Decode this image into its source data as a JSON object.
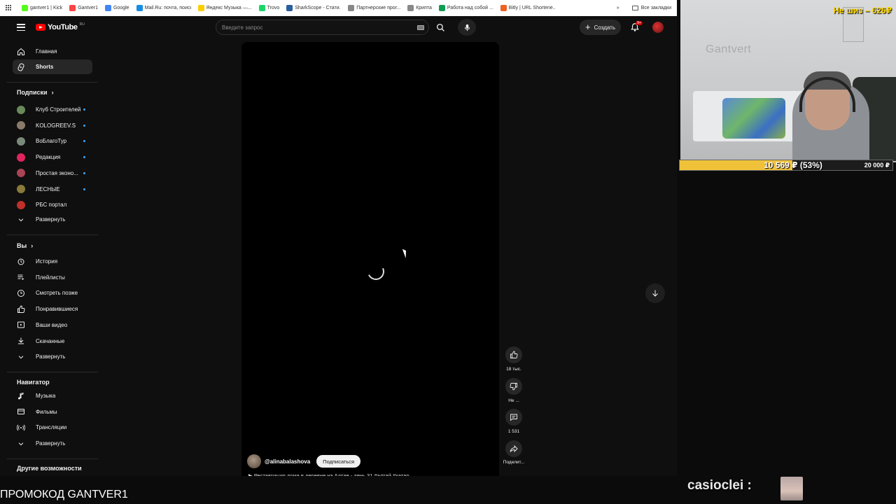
{
  "bookmarks": [
    {
      "label": "gantver1 | Kick",
      "color": "#53fc18"
    },
    {
      "label": "Gantver1",
      "color": "#ff4444"
    },
    {
      "label": "Google",
      "color": "#4285f4"
    },
    {
      "label": "Mail.Ru: почта, поиск...",
      "color": "#168de2"
    },
    {
      "label": "Яндекс Музыка —...",
      "color": "#ffcc00"
    },
    {
      "label": "Trovo",
      "color": "#19d66b"
    },
    {
      "label": "SharkScope - Стати...",
      "color": "#2a5d9f"
    },
    {
      "label": "Партнерские прог...",
      "color": "#888888"
    },
    {
      "label": "Крипта",
      "color": "#888888"
    },
    {
      "label": "Работа над собой ...",
      "color": "#0f9d58"
    },
    {
      "label": "Bitly | URL Shortene...",
      "color": "#ee6123"
    }
  ],
  "bookmarks_more": "»",
  "bookmarks_all": "Все закладки",
  "header": {
    "logo_text": "YouTube",
    "logo_region": "RU",
    "search_placeholder": "Введите запрос",
    "create_label": "Создать",
    "notifications_badge": "9+"
  },
  "sidebar": {
    "main": [
      {
        "label": "Главная",
        "icon": "home-icon"
      },
      {
        "label": "Shorts",
        "icon": "shorts-icon",
        "active": true
      }
    ],
    "subscriptions_title": "Подписки",
    "subscriptions": [
      {
        "label": "Клуб Строителей",
        "color": "#6a8a5a"
      },
      {
        "label": "KOLOGREEV.S",
        "color": "#8a7a6a"
      },
      {
        "label": "ВоБлагоТур",
        "color": "#7a8a7a"
      },
      {
        "label": "Редакция",
        "color": "#e0245e"
      },
      {
        "label": "Простая эконо...",
        "color": "#aa4455"
      },
      {
        "label": "ЛЕСНЫЕ",
        "color": "#8a7a3a"
      },
      {
        "label": "РБС портал",
        "color": "#c0302a"
      }
    ],
    "expand_1": "Развернуть",
    "you_title": "Вы",
    "you_items": [
      {
        "label": "История",
        "icon": "history-icon"
      },
      {
        "label": "Плейлисты",
        "icon": "playlists-icon"
      },
      {
        "label": "Смотреть позже",
        "icon": "watch-later-icon"
      },
      {
        "label": "Понравившиеся",
        "icon": "like-icon"
      },
      {
        "label": "Ваши видео",
        "icon": "your-videos-icon"
      },
      {
        "label": "Скачанные",
        "icon": "downloads-icon"
      }
    ],
    "expand_2": "Развернуть",
    "navigator_title": "Навигатор",
    "navigator_items": [
      {
        "label": "Музыка",
        "icon": "music-icon"
      },
      {
        "label": "Фильмы",
        "icon": "films-icon"
      },
      {
        "label": "Трансляции",
        "icon": "live-icon"
      }
    ],
    "expand_3": "Развернуть",
    "more_title": "Другие возможности"
  },
  "short": {
    "channel_handle": "@alinabalashova",
    "subscribe_label": "Подписаться",
    "title": "▶ Реставрация дома в деревне на Алтае - день 31 #алтай #хатар"
  },
  "actions": {
    "likes": "18 тыс.",
    "dislike": "Не ...",
    "comments": "1 531",
    "share": "Поделит..."
  },
  "overlay": {
    "donation_title": "Не шиз – 626₽",
    "wall_sign": "Gantvert",
    "goal_text": "10 569 ₽ (53%)",
    "goal_fraction": 0.53,
    "goal_target": "20 000 ₽",
    "promo": "ПРОМОКОД GANTVER1",
    "chat_user": "casioclei :"
  }
}
